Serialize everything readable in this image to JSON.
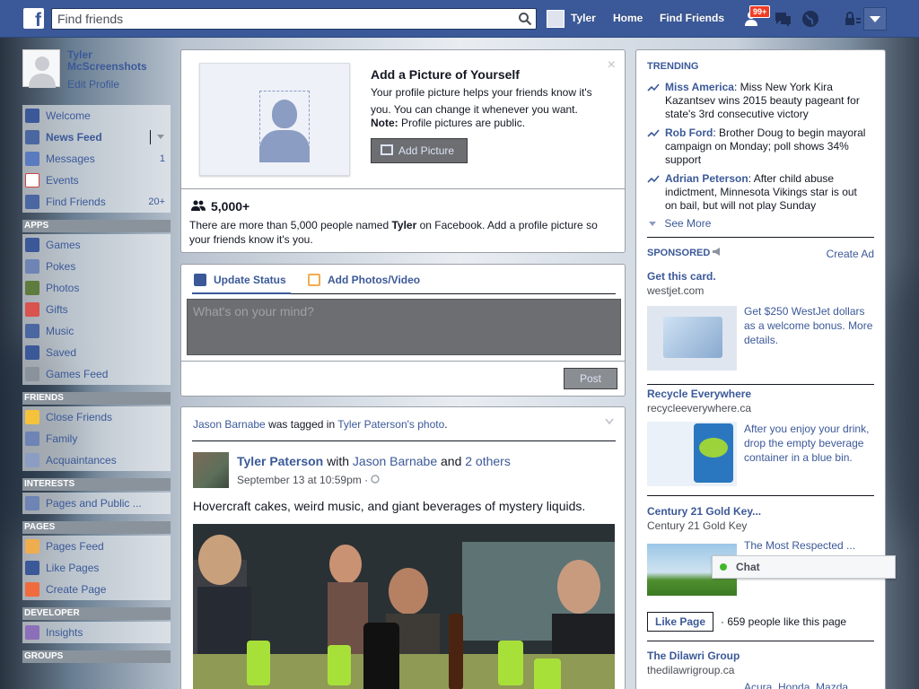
{
  "topbar": {
    "search_placeholder": "Find friends",
    "user_name": "Tyler",
    "home": "Home",
    "find_friends": "Find Friends",
    "friend_requests_badge": "99+"
  },
  "profile": {
    "name": "Tyler McScreenshots",
    "edit": "Edit Profile"
  },
  "nav_main": [
    {
      "label": "Welcome",
      "icon": "facebook-icon",
      "count": ""
    },
    {
      "label": "News Feed",
      "icon": "news-feed-icon",
      "count": ""
    },
    {
      "label": "Messages",
      "icon": "messages-icon",
      "count": "1"
    },
    {
      "label": "Events",
      "icon": "calendar-icon",
      "count": ""
    },
    {
      "label": "Find Friends",
      "icon": "find-friends-icon",
      "count": "20+"
    }
  ],
  "sections": {
    "apps": "APPS",
    "friends": "FRIENDS",
    "interests": "INTERESTS",
    "pages": "PAGES",
    "developer": "DEVELOPER",
    "groups": "GROUPS"
  },
  "nav_apps": [
    "Games",
    "Pokes",
    "Photos",
    "Gifts",
    "Music",
    "Saved",
    "Games Feed"
  ],
  "nav_friends": [
    "Close Friends",
    "Family",
    "Acquaintances"
  ],
  "nav_interests": [
    "Pages and Public ..."
  ],
  "nav_pages": [
    "Pages Feed",
    "Like Pages",
    "Create Page"
  ],
  "nav_developer": [
    "Insights"
  ],
  "add_picture": {
    "title": "Add a Picture of Yourself",
    "text": "Your profile picture helps your friends know it's you. You can change it whenever you want.",
    "note_label": "Note:",
    "note_text": " Profile pictures are public.",
    "button": "Add Picture",
    "close": "×",
    "people_count": "5,000+",
    "people_text_1": "There are more than 5,000 people named ",
    "people_name": "Tyler",
    "people_text_2": " on Facebook. Add a profile picture so your friends know it's you."
  },
  "composer": {
    "tab_status": "Update Status",
    "tab_photos": "Add Photos/Video",
    "placeholder": "What's on your mind?",
    "post": "Post"
  },
  "story": {
    "head_actor": "Jason Barnabe",
    "head_mid": " was tagged in ",
    "head_target": "Tyler Paterson's photo",
    "head_end": ".",
    "author": "Tyler Paterson",
    "with": " with ",
    "with_name": "Jason Barnabe",
    "and": " and ",
    "others": "2 others",
    "time": "September 13 at 10:59pm · ",
    "text": "Hovercraft cakes, weird music, and giant beverages of mystery liquids."
  },
  "trending": {
    "title": "TRENDING",
    "items": [
      {
        "name": "Miss America",
        "text": ": Miss New York Kira Kazantsev wins 2015 beauty pageant for state's 3rd consecutive victory"
      },
      {
        "name": "Rob Ford",
        "text": ": Brother Doug to begin mayoral campaign on Monday; poll shows 34% support"
      },
      {
        "name": "Adrian Peterson",
        "text": ": After child abuse indictment, Minnesota Vikings star is out on bail, but will not play Sunday"
      }
    ],
    "see_more": "See More"
  },
  "sponsored": {
    "title": "SPONSORED",
    "create_ad": "Create Ad",
    "ads": [
      {
        "title": "Get this card.",
        "url": "westjet.com",
        "text": "Get $250 WestJet dollars as a welcome bonus. More details."
      },
      {
        "title": "Recycle Everywhere",
        "url": "recycleeverywhere.ca",
        "text": "After you enjoy your drink, drop the empty beverage container in a blue bin."
      },
      {
        "title": "Century 21 Gold Key...",
        "url": "Century 21 Gold Key",
        "text": "The Most Respected ... listings! We Know Homes."
      },
      {
        "title": "The Dilawri Group",
        "url": "thedilawrigroup.ca",
        "text": "Acura, Honda, Mazda"
      }
    ],
    "like_page": "Like Page",
    "like_text": "· 659 people like this page"
  },
  "chat": {
    "label": "Chat"
  }
}
